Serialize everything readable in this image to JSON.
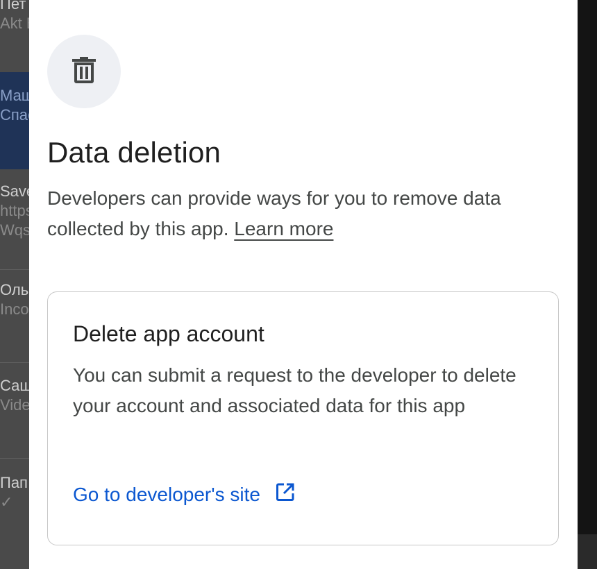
{
  "background": {
    "items": [
      {
        "title": "Пет",
        "sub": "Akt B"
      },
      {
        "title": "Маш",
        "sub": "Спас"
      },
      {
        "title": "Save",
        "sub": "https",
        "sub2": "Wqs"
      },
      {
        "title": "Ольг",
        "sub": "Inco"
      },
      {
        "title": "Саш",
        "sub": "Vide"
      },
      {
        "title": "Пап",
        "sub": "✓"
      }
    ]
  },
  "dialog": {
    "title": "Data deletion",
    "description": "Developers can provide ways for you to remove data collected by this app.",
    "learn_more": "Learn more",
    "card": {
      "title": "Delete app account",
      "body": "You can submit a request to the developer to delete your account and associated data for this app",
      "link_label": "Go to developer's site"
    },
    "icon": "trash-icon",
    "link_icon": "open-in-new-icon"
  },
  "colors": {
    "link": "#0b57d0",
    "icon_circle": "#eef0f4",
    "card_border": "#c7c7c7"
  }
}
